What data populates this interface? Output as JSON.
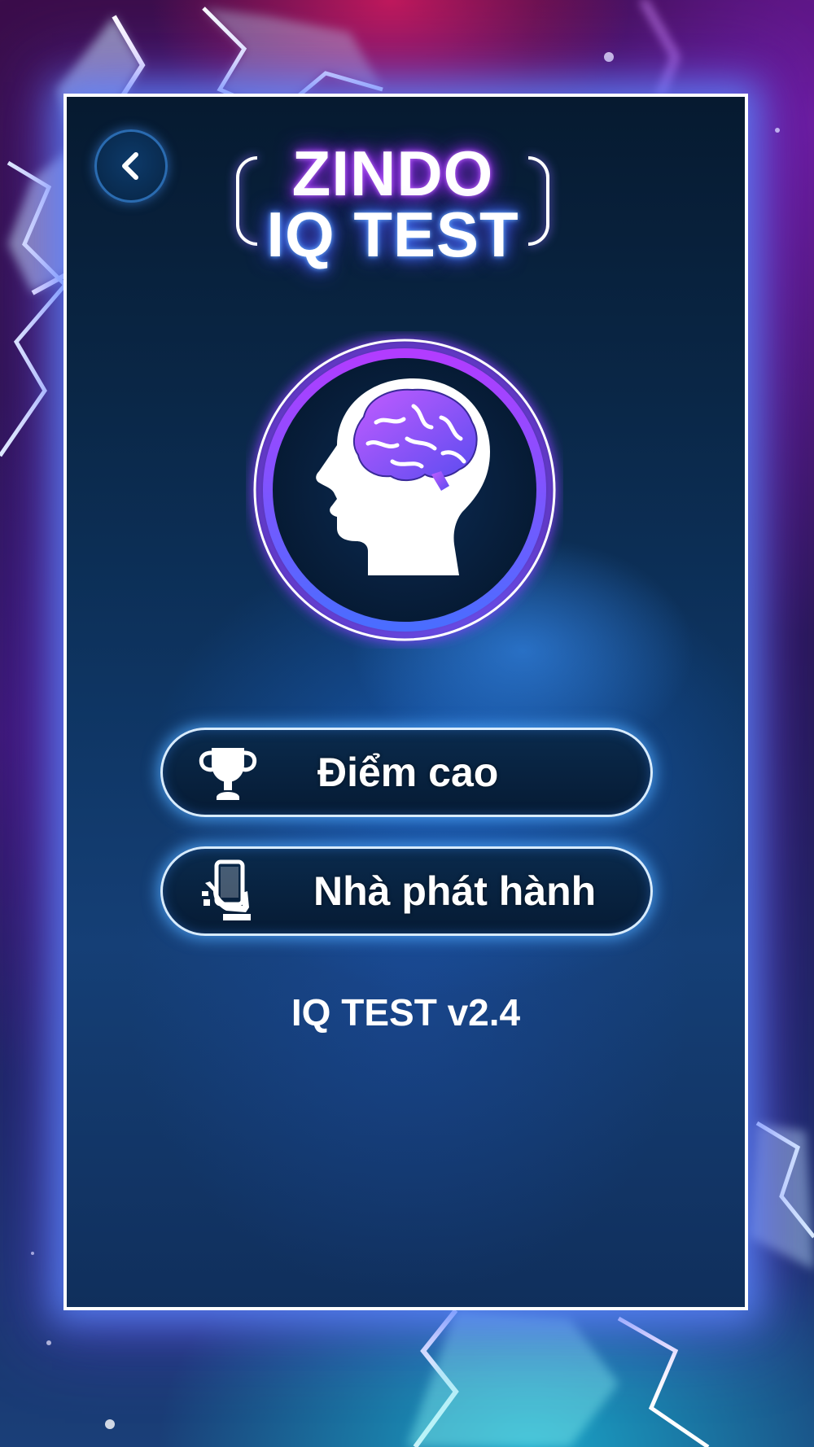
{
  "screen": {
    "back_button": {
      "icon": "chevron-left-icon"
    },
    "logo": {
      "line1": "ZINDO",
      "line2": "IQ TEST"
    },
    "emblem": {
      "icon": "brain-head-icon"
    },
    "menu": [
      {
        "label": "Điểm cao",
        "icon": "trophy-icon"
      },
      {
        "label": "Nhà phát hành",
        "icon": "phone-in-hand-icon"
      }
    ],
    "version": "IQ TEST v2.4"
  },
  "colors": {
    "accent_purple": "#a030ff",
    "accent_blue": "#3c7dff",
    "button_border": "#d8ecff",
    "panel_top": "#061a30",
    "panel_bottom": "#153f76"
  }
}
